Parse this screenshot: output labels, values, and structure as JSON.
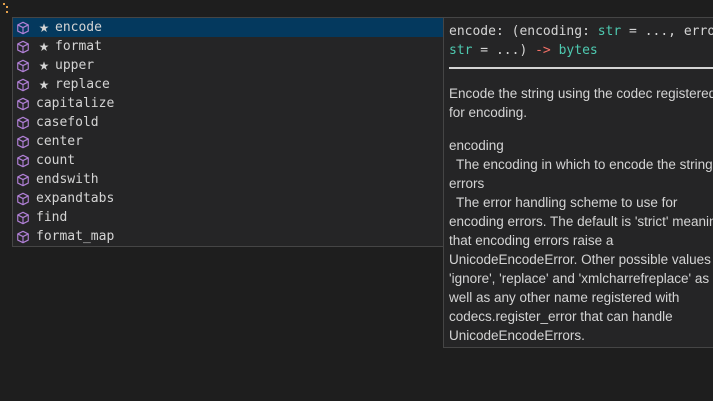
{
  "colors": {
    "editor_bg": "#1e1e1e",
    "widget_bg": "#252526",
    "widget_border": "#454545",
    "selected_row": "#04395e",
    "method_icon": "#b180d7",
    "type_teal": "#4ec9b0",
    "arrow_red": "#f47067",
    "text": "#d4d4d4"
  },
  "suggestions": [
    {
      "icon": "method-cube-icon",
      "starred": true,
      "star": "★",
      "label": "encode",
      "selected": true
    },
    {
      "icon": "method-cube-icon",
      "starred": true,
      "star": "★",
      "label": "format",
      "selected": false
    },
    {
      "icon": "method-cube-icon",
      "starred": true,
      "star": "★",
      "label": "upper",
      "selected": false
    },
    {
      "icon": "method-cube-icon",
      "starred": true,
      "star": "★",
      "label": "replace",
      "selected": false
    },
    {
      "icon": "method-cube-icon",
      "starred": false,
      "star": "",
      "label": "capitalize",
      "selected": false
    },
    {
      "icon": "method-cube-icon",
      "starred": false,
      "star": "",
      "label": "casefold",
      "selected": false
    },
    {
      "icon": "method-cube-icon",
      "starred": false,
      "star": "",
      "label": "center",
      "selected": false
    },
    {
      "icon": "method-cube-icon",
      "starred": false,
      "star": "",
      "label": "count",
      "selected": false
    },
    {
      "icon": "method-cube-icon",
      "starred": false,
      "star": "",
      "label": "endswith",
      "selected": false
    },
    {
      "icon": "method-cube-icon",
      "starred": false,
      "star": "",
      "label": "expandtabs",
      "selected": false
    },
    {
      "icon": "method-cube-icon",
      "starred": false,
      "star": "",
      "label": "find",
      "selected": false
    },
    {
      "icon": "method-cube-icon",
      "starred": false,
      "star": "",
      "label": "format_map",
      "selected": false
    }
  ],
  "details": {
    "signature": {
      "name": "encode",
      "colon_paren": ": (",
      "param1": "encoding",
      "colon1": ": ",
      "type1": "str",
      "default1": " = ..., ",
      "param2": "errors",
      "colon2": ": ",
      "type2": "str",
      "default2": " = ...) ",
      "arrow": "->",
      "return_type": "bytes"
    },
    "description": [
      "Encode the string using the codec registered",
      "for encoding."
    ],
    "params": [
      {
        "name": "encoding",
        "lines": [
          "The encoding in which to encode the string."
        ]
      },
      {
        "name": "errors",
        "lines": [
          "The error handling scheme to use for",
          "encoding errors. The default is 'strict' meaning",
          "that encoding errors raise a",
          "UnicodeEncodeError. Other possible values are",
          "'ignore', 'replace' and 'xmlcharrefreplace' as",
          "well as any other name registered with",
          "codecs.register_error that can handle",
          "UnicodeEncodeErrors."
        ]
      }
    ]
  }
}
